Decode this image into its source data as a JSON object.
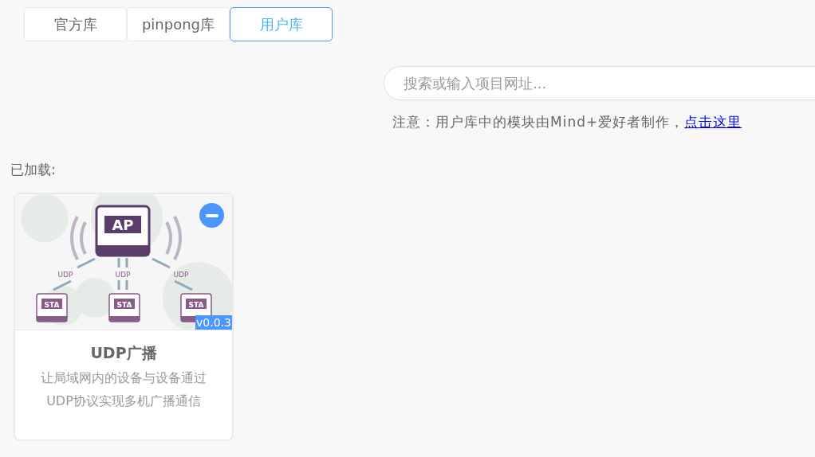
{
  "tabs": [
    {
      "label": "官方库",
      "selected": false
    },
    {
      "label": "pinpong库",
      "selected": false
    },
    {
      "label": "用户库",
      "selected": true
    }
  ],
  "search": {
    "placeholder": "搜索或输入项目网址..."
  },
  "notice": {
    "text": "注意：用户库中的模块由Mind+爱好者制作，",
    "link": "点击这里"
  },
  "loaded_label": "已加载:",
  "cards": [
    {
      "illustration": {
        "ap_label": "AP",
        "udp_labels": [
          "UDP",
          "UDP",
          "UDP"
        ],
        "sta_labels": [
          "STA",
          "STA",
          "STA"
        ]
      },
      "version": "v0.0.3",
      "title": "UDP广播",
      "description": [
        "让局域网内的设备与设备通过",
        "UDP协议实现多机广播通信"
      ]
    }
  ]
}
